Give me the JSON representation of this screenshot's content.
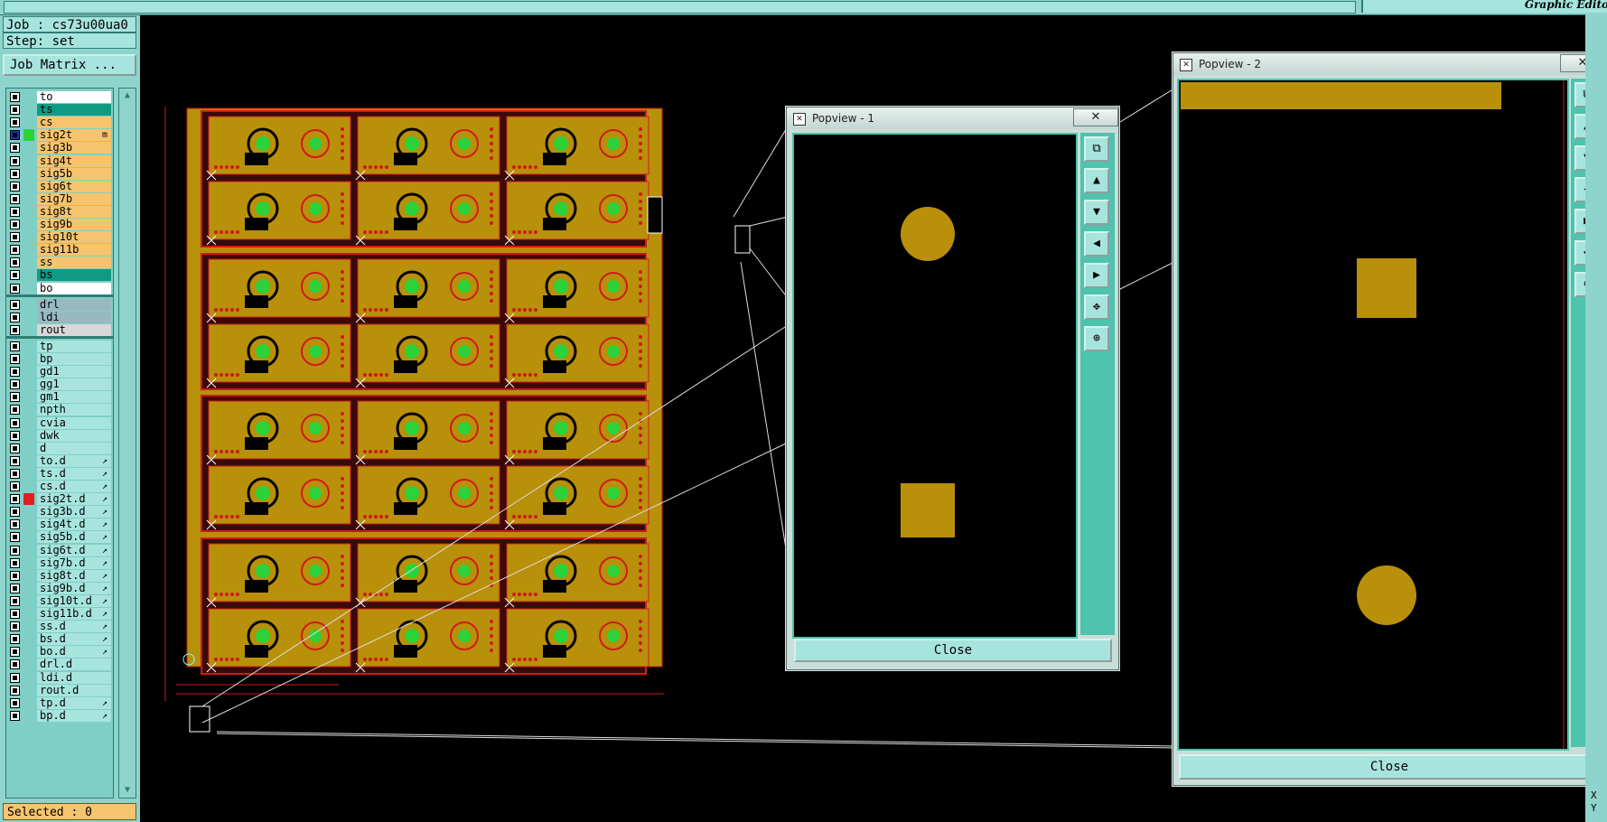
{
  "app": {
    "title": "Graphic Edito"
  },
  "job": {
    "label": "Job : cs73u00ua0"
  },
  "step": {
    "label": "Step: set"
  },
  "job_matrix_button": "Job Matrix ...",
  "layers": [
    {
      "name": "to",
      "color": "#ffffff",
      "group": 1
    },
    {
      "name": "ts",
      "color": "#0f9b83",
      "group": 1
    },
    {
      "name": "cs",
      "color": "#f6c46e",
      "group": 1
    },
    {
      "name": "sig2t",
      "color": "#f6c46e",
      "group": 1,
      "active": true,
      "flag": "m"
    },
    {
      "name": "sig3b",
      "color": "#f6c46e",
      "group": 1
    },
    {
      "name": "sig4t",
      "color": "#f6c46e",
      "group": 1
    },
    {
      "name": "sig5b",
      "color": "#f6c46e",
      "group": 1
    },
    {
      "name": "sig6t",
      "color": "#f6c46e",
      "group": 1
    },
    {
      "name": "sig7b",
      "color": "#f6c46e",
      "group": 1
    },
    {
      "name": "sig8t",
      "color": "#f6c46e",
      "group": 1
    },
    {
      "name": "sig9b",
      "color": "#f6c46e",
      "group": 1
    },
    {
      "name": "sig10t",
      "color": "#f6c46e",
      "group": 1
    },
    {
      "name": "sig11b",
      "color": "#f6c46e",
      "group": 1
    },
    {
      "name": "ss",
      "color": "#f6c46e",
      "group": 1
    },
    {
      "name": "bs",
      "color": "#0f9b83",
      "group": 1
    },
    {
      "name": "bo",
      "color": "#ffffff",
      "group": 1
    },
    {
      "name": "drl",
      "color": "#99b9c1",
      "group": 2
    },
    {
      "name": "ldi",
      "color": "#99b9c1",
      "group": 2
    },
    {
      "name": "rout",
      "color": "#d7d7d7",
      "group": 2
    },
    {
      "name": "tp",
      "color": "#a8e4de",
      "group": 3
    },
    {
      "name": "bp",
      "color": "#a8e4de",
      "group": 3
    },
    {
      "name": "gd1",
      "color": "#a8e4de",
      "group": 3
    },
    {
      "name": "gg1",
      "color": "#a8e4de",
      "group": 3
    },
    {
      "name": "gm1",
      "color": "#a8e4de",
      "group": 3
    },
    {
      "name": "npth",
      "color": "#a8e4de",
      "group": 3
    },
    {
      "name": "cvia",
      "color": "#a8e4de",
      "group": 3
    },
    {
      "name": "dwk",
      "color": "#a8e4de",
      "group": 3
    },
    {
      "name": "d",
      "color": "#a8e4de",
      "group": 3
    },
    {
      "name": "to.d",
      "color": "#a8e4de",
      "group": 3,
      "flag": "↗"
    },
    {
      "name": "ts.d",
      "color": "#a8e4de",
      "group": 3,
      "flag": "↗"
    },
    {
      "name": "cs.d",
      "color": "#a8e4de",
      "group": 3,
      "flag": "↗"
    },
    {
      "name": "sig2t.d",
      "color": "#a8e4de",
      "group": 3,
      "flag": "↗",
      "marker": "#e21f1f"
    },
    {
      "name": "sig3b.d",
      "color": "#a8e4de",
      "group": 3,
      "flag": "↗"
    },
    {
      "name": "sig4t.d",
      "color": "#a8e4de",
      "group": 3,
      "flag": "↗"
    },
    {
      "name": "sig5b.d",
      "color": "#a8e4de",
      "group": 3,
      "flag": "↗"
    },
    {
      "name": "sig6t.d",
      "color": "#a8e4de",
      "group": 3,
      "flag": "↗"
    },
    {
      "name": "sig7b.d",
      "color": "#a8e4de",
      "group": 3,
      "flag": "↗"
    },
    {
      "name": "sig8t.d",
      "color": "#a8e4de",
      "group": 3,
      "flag": "↗"
    },
    {
      "name": "sig9b.d",
      "color": "#a8e4de",
      "group": 3,
      "flag": "↗"
    },
    {
      "name": "sig10t.d",
      "color": "#a8e4de",
      "group": 3,
      "flag": "↗"
    },
    {
      "name": "sig11b.d",
      "color": "#a8e4de",
      "group": 3,
      "flag": "↗"
    },
    {
      "name": "ss.d",
      "color": "#a8e4de",
      "group": 3,
      "flag": "↗"
    },
    {
      "name": "bs.d",
      "color": "#a8e4de",
      "group": 3,
      "flag": "↗"
    },
    {
      "name": "bo.d",
      "color": "#a8e4de",
      "group": 3,
      "flag": "↗"
    },
    {
      "name": "drl.d",
      "color": "#a8e4de",
      "group": 3
    },
    {
      "name": "ldi.d",
      "color": "#a8e4de",
      "group": 3
    },
    {
      "name": "rout.d",
      "color": "#a8e4de",
      "group": 3
    },
    {
      "name": "tp.d",
      "color": "#a8e4de",
      "group": 3,
      "flag": "↗"
    },
    {
      "name": "bp.d",
      "color": "#a8e4de",
      "group": 3,
      "flag": "↗"
    }
  ],
  "status": {
    "selected": "Selected : 0"
  },
  "popview1": {
    "title": "Popview - 1",
    "close_x": "✕",
    "close_button": "Close"
  },
  "popview2": {
    "title": "Popview - 2",
    "close_x": "✕",
    "close_button": "Close"
  },
  "toolbar_icons": [
    "zoom-fit-icon",
    "zoom-in-icon",
    "zoom-out-icon",
    "pan-left-icon",
    "pan-right-icon",
    "zoom-home-icon",
    "zoom-area-icon"
  ],
  "toolbar_glyphs": [
    "⧉",
    "▲",
    "▼",
    "◀",
    "▶",
    "✥",
    "⊕"
  ],
  "xy_readout": {
    "x": "X",
    "y": "Y"
  },
  "colors": {
    "copper": "#b8900a",
    "outline": "#d01a1a",
    "pad": "#2bd23a",
    "panel": "#8fd4cc",
    "accent": "#4ec3ad"
  }
}
